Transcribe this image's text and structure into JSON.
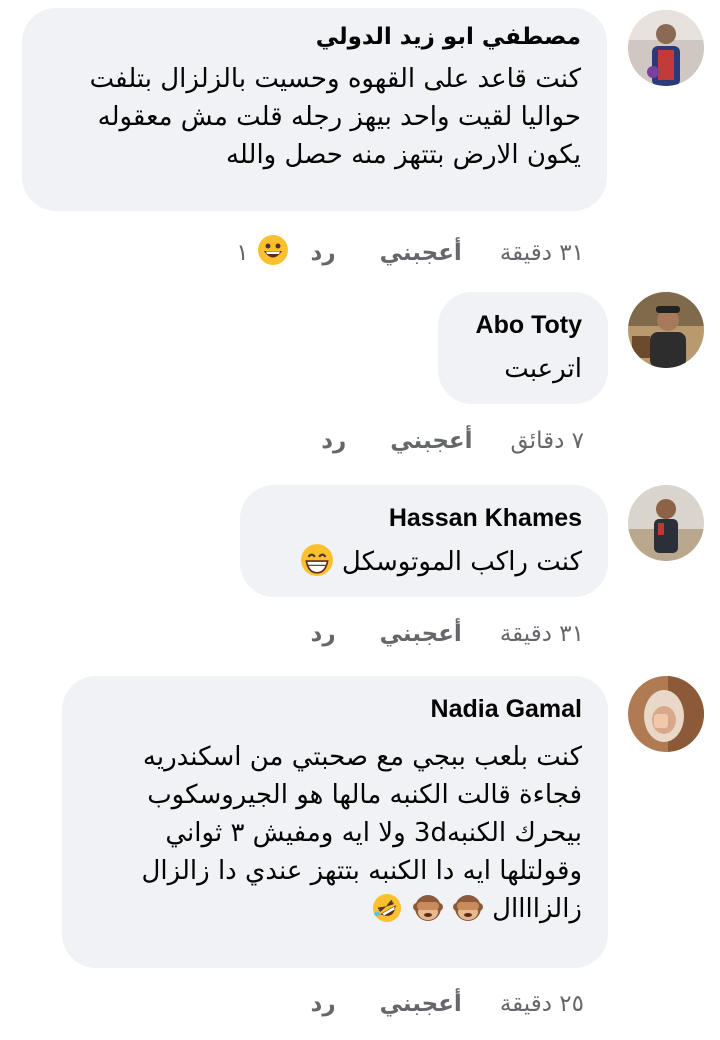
{
  "comments": [
    {
      "author": "مصطفي ابو زيد الدولي",
      "lines": [
        "كنت قاعد على القهوه وحسيت بالزلزال بتلفت",
        "حواليا لقيت واحد بيهز رجله قلت مش معقوله",
        "يكون الارض بتتهز منه حصل والله"
      ],
      "time": "٣١ دقيقة",
      "like": "أعجبني",
      "reply": "رد",
      "reaction_count": "١"
    },
    {
      "author": "Abo Toty",
      "lines": [
        "اترعبت"
      ],
      "time": "٧ دقائق",
      "like": "أعجبني",
      "reply": "رد"
    },
    {
      "author": "Hassan Khames",
      "lines": [
        "كنت راكب الموتوسكل"
      ],
      "time": "٣١ دقيقة",
      "like": "أعجبني",
      "reply": "رد"
    },
    {
      "author": "Nadia Gamal",
      "lines": [
        "كنت بلعب ببجي مع صحبتي من اسكندريه",
        "فجاءة قالت الكنبه مالها هو الجيروسكوب",
        "بيحرك الكنبه3d ولا ايه ومفيش ٣ ثواني",
        "وقولتلها ايه دا الكنبه بتتهز عندي دا زالزال",
        "زالزاااال"
      ],
      "time": "٢٥ دقيقة",
      "like": "أعجبني",
      "reply": "رد"
    }
  ],
  "icons": {
    "grin": "grinning-face-icon",
    "laugh": "rolling-laughing-face-icon",
    "monkey": "see-no-evil-monkey-icon"
  },
  "colors": {
    "bubble": "#f0f2f5",
    "meta": "#65676b",
    "text": "#050505"
  }
}
